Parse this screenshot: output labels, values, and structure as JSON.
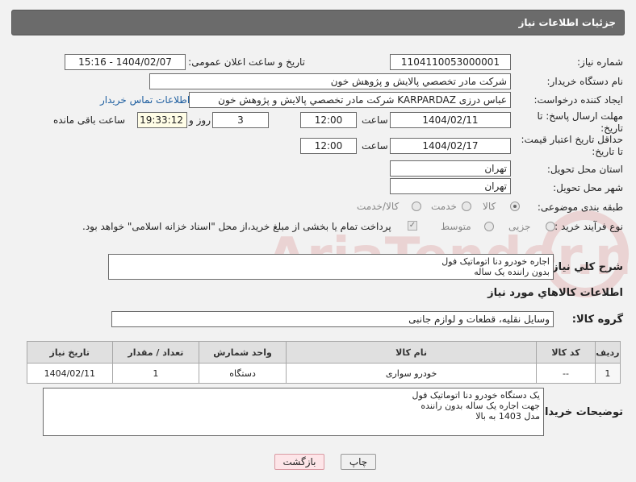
{
  "header": {
    "title": "جزئیات اطلاعات نیاز"
  },
  "labels": {
    "need_number": "شماره نیاز:",
    "announce_datetime": "تاریخ و ساعت اعلان عمومی:",
    "buyer_org": "نام دستگاه خریدار:",
    "requester": "ایجاد کننده درخواست:",
    "reply_deadline": "مهلت ارسال پاسخ: تا تاریخ:",
    "time": "ساعت",
    "day_and": "روز و",
    "remaining": "ساعت باقی مانده",
    "price_validity": "حداقل تاریخ اعتبار قیمت: تا تاریخ:",
    "delivery_province": "استان محل تحویل:",
    "delivery_city": "شهر محل تحویل:",
    "category": "طبقه بندی موضوعی:",
    "process_type": "نوع فرآیند خرید :",
    "description": "شرح کلي نياز:",
    "goods_info": "اطلاعات کالاهاي مورد نياز",
    "goods_group": "گروه کالا:",
    "buyer_notes": "توضیحات خریدار:"
  },
  "values": {
    "need_number": "1104110053000001",
    "announce_datetime": "1404/02/07 - 15:16",
    "buyer_org": "شرکت مادر تخصصي پالايش و پژوهش خون",
    "requester": "عباس درزی KARPARDAZ شرکت مادر تخصصي پالايش و پژوهش خون",
    "contact_link": "اطلاعات تماس خریدار",
    "reply_date": "1404/02/11",
    "reply_time": "12:00",
    "reply_days": "3",
    "remaining_time": "19:33:12",
    "validity_date": "1404/02/17",
    "validity_time": "12:00",
    "province": "تهران",
    "city": "تهران",
    "description": "اجاره خودرو دنا اتوماتیک فول\nبدون راننده یک ساله",
    "goods_group": "وسایل نقلیه، قطعات و لوازم جانبی",
    "buyer_notes": "یک دستگاه خودرو دنا اتوماتیک فول\nجهت اجاره یک ساله بدون راننده\nمدل 1403 به بالا"
  },
  "category_options": [
    "کالا",
    "خدمت",
    "کالا/خدمت"
  ],
  "process_options": [
    "جزیی",
    "متوسط"
  ],
  "payment_note": "پرداخت تمام یا بخشی از مبلغ خرید،از محل \"اسناد خزانه اسلامی\" خواهد بود.",
  "table": {
    "headers": [
      "ردیف",
      "کد کالا",
      "نام کالا",
      "واحد شمارش",
      "تعداد / مقدار",
      "تاریخ نیاز"
    ],
    "rows": [
      [
        "1",
        "--",
        "خودرو سواری",
        "دستگاه",
        "1",
        "1404/02/11"
      ]
    ]
  },
  "buttons": {
    "print": "چاپ",
    "back": "بازگشت"
  },
  "watermark": "AriaTender.neT",
  "colors": {
    "header_bg": "#6b6b6b",
    "link": "#1f5fa0",
    "back_button": "#fde5e8"
  }
}
